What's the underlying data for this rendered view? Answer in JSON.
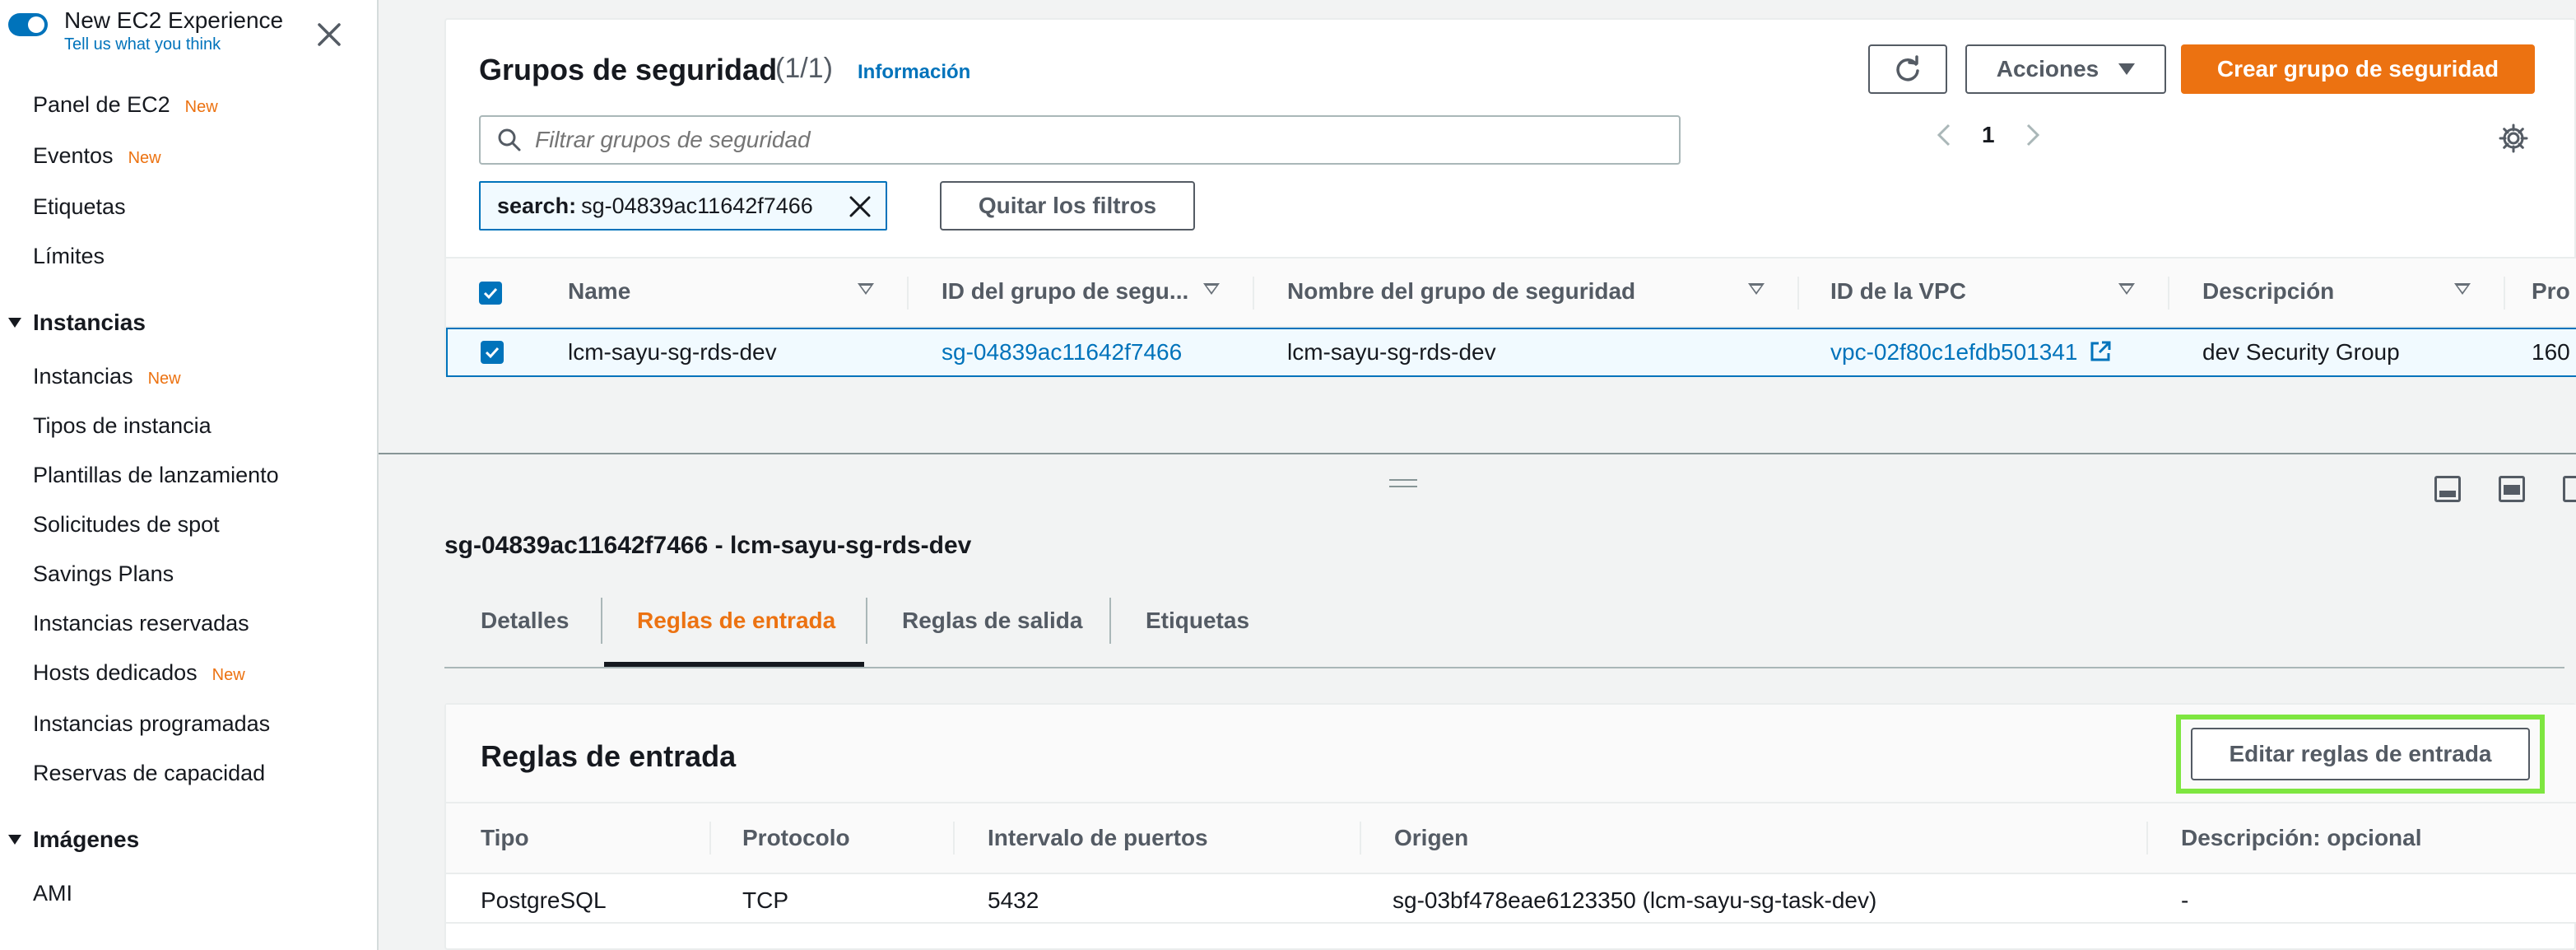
{
  "sidebar": {
    "experience_title": "New EC2 Experience",
    "experience_link": "Tell us what you think",
    "items_top": [
      {
        "label": "Panel de EC2",
        "badge": "New"
      },
      {
        "label": "Eventos",
        "badge": "New"
      },
      {
        "label": "Etiquetas",
        "badge": ""
      },
      {
        "label": "Límites",
        "badge": ""
      }
    ],
    "section_instances": "Instancias",
    "items_instances": [
      {
        "label": "Instancias",
        "badge": "New"
      },
      {
        "label": "Tipos de instancia",
        "badge": ""
      },
      {
        "label": "Plantillas de lanzamiento",
        "badge": ""
      },
      {
        "label": "Solicitudes de spot",
        "badge": ""
      },
      {
        "label": "Savings Plans",
        "badge": ""
      },
      {
        "label": "Instancias reservadas",
        "badge": ""
      },
      {
        "label": "Hosts dedicados",
        "badge": "New"
      },
      {
        "label": "Instancias programadas",
        "badge": ""
      },
      {
        "label": "Reservas de capacidad",
        "badge": ""
      }
    ],
    "section_images": "Imágenes",
    "items_images": [
      {
        "label": "AMI",
        "badge": ""
      }
    ]
  },
  "security_groups": {
    "title": "Grupos de seguridad",
    "count": "(1/1)",
    "info_link": "Información",
    "actions_label": "Acciones",
    "create_label": "Crear grupo de seguridad",
    "search_placeholder": "Filtrar grupos de seguridad",
    "filter_token_key": "search:",
    "filter_token_value": "sg-04839ac11642f7466",
    "clear_filters_label": "Quitar los filtros",
    "page_number": "1",
    "columns": [
      "Name",
      "ID del grupo de segu...",
      "Nombre del grupo de seguridad",
      "ID de la VPC",
      "Descripción",
      "Pro"
    ],
    "rows": [
      {
        "name": "lcm-sayu-sg-rds-dev",
        "group_id": "sg-04839ac11642f7466",
        "group_name": "lcm-sayu-sg-rds-dev",
        "vpc_id": "vpc-02f80c1efdb501341",
        "description": "dev Security Group",
        "pro": "160"
      }
    ]
  },
  "details": {
    "title": "sg-04839ac11642f7466 - lcm-sayu-sg-rds-dev",
    "tabs": [
      "Detalles",
      "Reglas de entrada",
      "Reglas de salida",
      "Etiquetas"
    ],
    "active_tab": "Reglas de entrada"
  },
  "inbound_rules": {
    "title": "Reglas de entrada",
    "edit_label": "Editar reglas de entrada",
    "columns": [
      "Tipo",
      "Protocolo",
      "Intervalo de puertos",
      "Origen",
      "Descripción: opcional"
    ],
    "rows": [
      {
        "type": "PostgreSQL",
        "protocol": "TCP",
        "port_range": "5432",
        "source": "sg-03bf478eae6123350 (lcm-sayu-sg-task-dev)",
        "description": "-"
      }
    ]
  },
  "colors": {
    "accent": "#0073bb",
    "primary_button": "#ec7211",
    "highlight": "#7ee640"
  }
}
